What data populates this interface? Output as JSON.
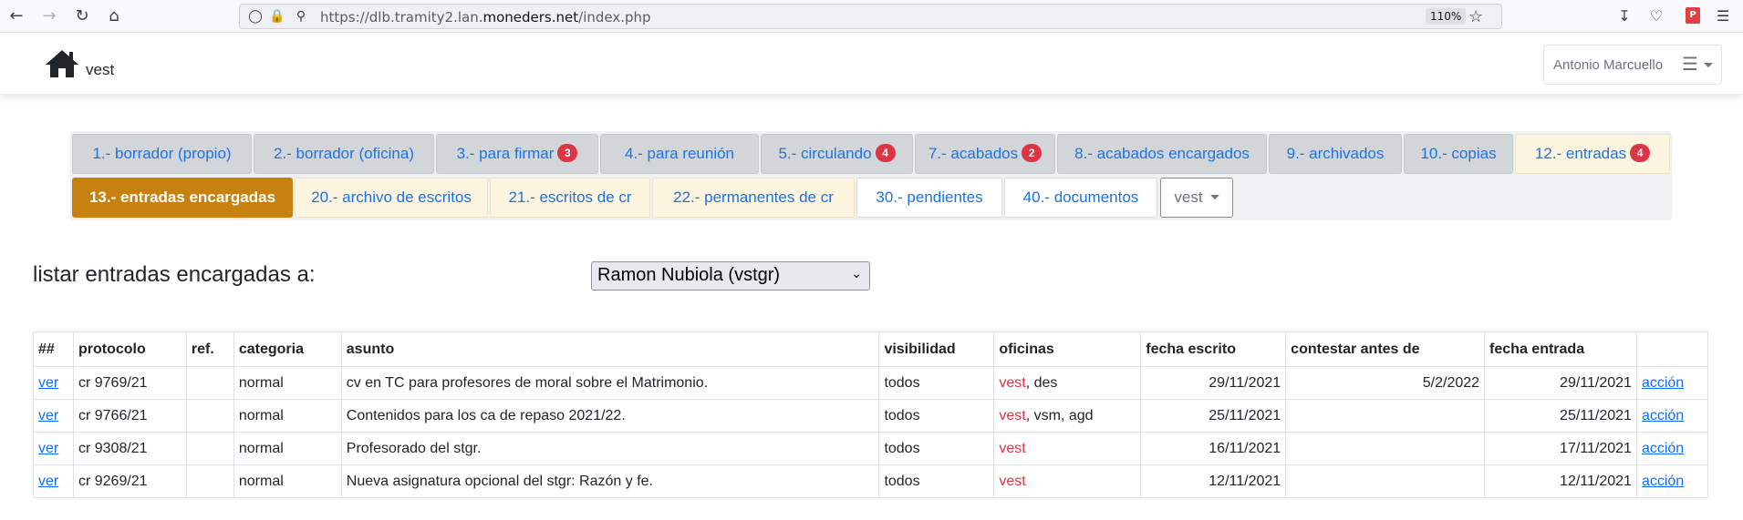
{
  "browser": {
    "url_prefix": "https://dlb.tramity2.lan.",
    "url_host": "moneders.net",
    "url_path": "/index.php",
    "zoom": "110%"
  },
  "header": {
    "brand": "vest",
    "user": "Antonio Marcuello"
  },
  "tabs": [
    {
      "label": "1.- borrador (propio)",
      "badge": ""
    },
    {
      "label": "2.- borrador (oficina)",
      "badge": ""
    },
    {
      "label": "3.- para firmar",
      "badge": "3"
    },
    {
      "label": "4.- para reunión",
      "badge": ""
    },
    {
      "label": "5.- circulando",
      "badge": "4"
    },
    {
      "label": "7.- acabados",
      "badge": "2"
    },
    {
      "label": "8.- acabados encargados",
      "badge": ""
    },
    {
      "label": "9.- archivados",
      "badge": ""
    },
    {
      "label": "10.- copias",
      "badge": ""
    },
    {
      "label": "12.- entradas",
      "badge": "4"
    },
    {
      "label": "13.- entradas encargadas",
      "badge": ""
    },
    {
      "label": "20.- archivo de escritos",
      "badge": ""
    },
    {
      "label": "21.- escritos de cr",
      "badge": ""
    },
    {
      "label": "22.- permanentes de cr",
      "badge": ""
    },
    {
      "label": "30.- pendientes",
      "badge": ""
    },
    {
      "label": "40.- documentos",
      "badge": ""
    },
    {
      "label": "vest",
      "badge": ""
    }
  ],
  "filter": {
    "label": "listar entradas encargadas a:",
    "selected": "Ramon Nubiola (vstgr)"
  },
  "table": {
    "headers": [
      "##",
      "protocolo",
      "ref.",
      "categoria",
      "asunto",
      "visibilidad",
      "oficinas",
      "fecha escrito",
      "contestar antes de",
      "fecha entrada",
      ""
    ],
    "rows": [
      {
        "ver": "ver",
        "protocolo": "cr 9769/21",
        "ref": "",
        "categoria": "normal",
        "asunto": "cv en TC para profesores de moral sobre el Matrimonio.",
        "visibilidad": "todos",
        "oficina_main": "vest",
        "oficina_rest": ", des",
        "fecha_escrito": "29/11/2021",
        "contestar": "5/2/2022",
        "fecha_entrada": "29/11/2021",
        "accion": "acción"
      },
      {
        "ver": "ver",
        "protocolo": "cr 9766/21",
        "ref": "",
        "categoria": "normal",
        "asunto": "Contenidos para los ca de repaso 2021/22.",
        "visibilidad": "todos",
        "oficina_main": "vest",
        "oficina_rest": ", vsm, agd",
        "fecha_escrito": "25/11/2021",
        "contestar": "",
        "fecha_entrada": "25/11/2021",
        "accion": "acción"
      },
      {
        "ver": "ver",
        "protocolo": "cr 9308/21",
        "ref": "",
        "categoria": "normal",
        "asunto": "Profesorado del stgr.",
        "visibilidad": "todos",
        "oficina_main": "vest",
        "oficina_rest": "",
        "fecha_escrito": "16/11/2021",
        "contestar": "",
        "fecha_entrada": "17/11/2021",
        "accion": "acción"
      },
      {
        "ver": "ver",
        "protocolo": "cr 9269/21",
        "ref": "",
        "categoria": "normal",
        "asunto": "Nueva asignatura opcional del stgr: Razón y fe.",
        "visibilidad": "todos",
        "oficina_main": "vest",
        "oficina_rest": "",
        "fecha_escrito": "12/11/2021",
        "contestar": "",
        "fecha_entrada": "12/11/2021",
        "accion": "acción"
      }
    ]
  }
}
